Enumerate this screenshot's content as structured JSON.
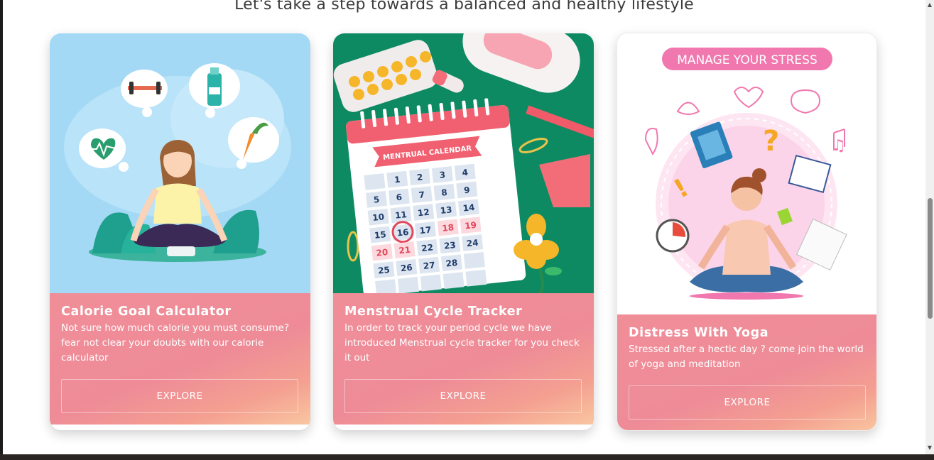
{
  "heading": "Let's take a step towards a balanced and healthy lifestyle",
  "cards": [
    {
      "title": "Calorie Goal Calculator",
      "description": "Not sure how much calorie you must consume? fear not clear your doubts with our calorie calculator",
      "button": "EXPLORE"
    },
    {
      "title": "Menstrual Cycle Tracker",
      "description": "In order to track your period cycle we have introduced Menstrual cycle tracker for you check it out",
      "button": "EXPLORE",
      "calendar_title": "MENTRUAL CALENDAR",
      "calendar_days": [
        "1",
        "2",
        "3",
        "4",
        "5",
        "6",
        "7",
        "8",
        "9",
        "10",
        "11",
        "12",
        "13",
        "14",
        "15",
        "16",
        "17",
        "18",
        "19",
        "20",
        "21",
        "22",
        "23",
        "24",
        "25",
        "26",
        "27",
        "28"
      ],
      "highlighted_day": "16"
    },
    {
      "title": "Distress With Yoga",
      "description": "Stressed after a hectic day ? come join the world of yoga and meditation",
      "button": "EXPLORE",
      "banner": "MANAGE YOUR STRESS"
    }
  ],
  "colors": {
    "card_gradient": "#ee8b97",
    "card_gradient_end": "#f9c6a0",
    "sky": "#a4d9f5",
    "green": "#0e8a63",
    "pink": "#f178ae"
  },
  "icons": [
    "dumbbell-icon",
    "water-bottle-icon",
    "carrot-icon",
    "heartbeat-icon",
    "pills-icon",
    "paperclip-icon",
    "flower-icon",
    "clock-icon",
    "music-note-icon",
    "question-mark-icon",
    "book-icon",
    "calendar-icon",
    "lotus-icon",
    "brain-icon",
    "heart-pulse-icon"
  ],
  "scrollbar": {
    "up": "▲",
    "down": "▼"
  }
}
